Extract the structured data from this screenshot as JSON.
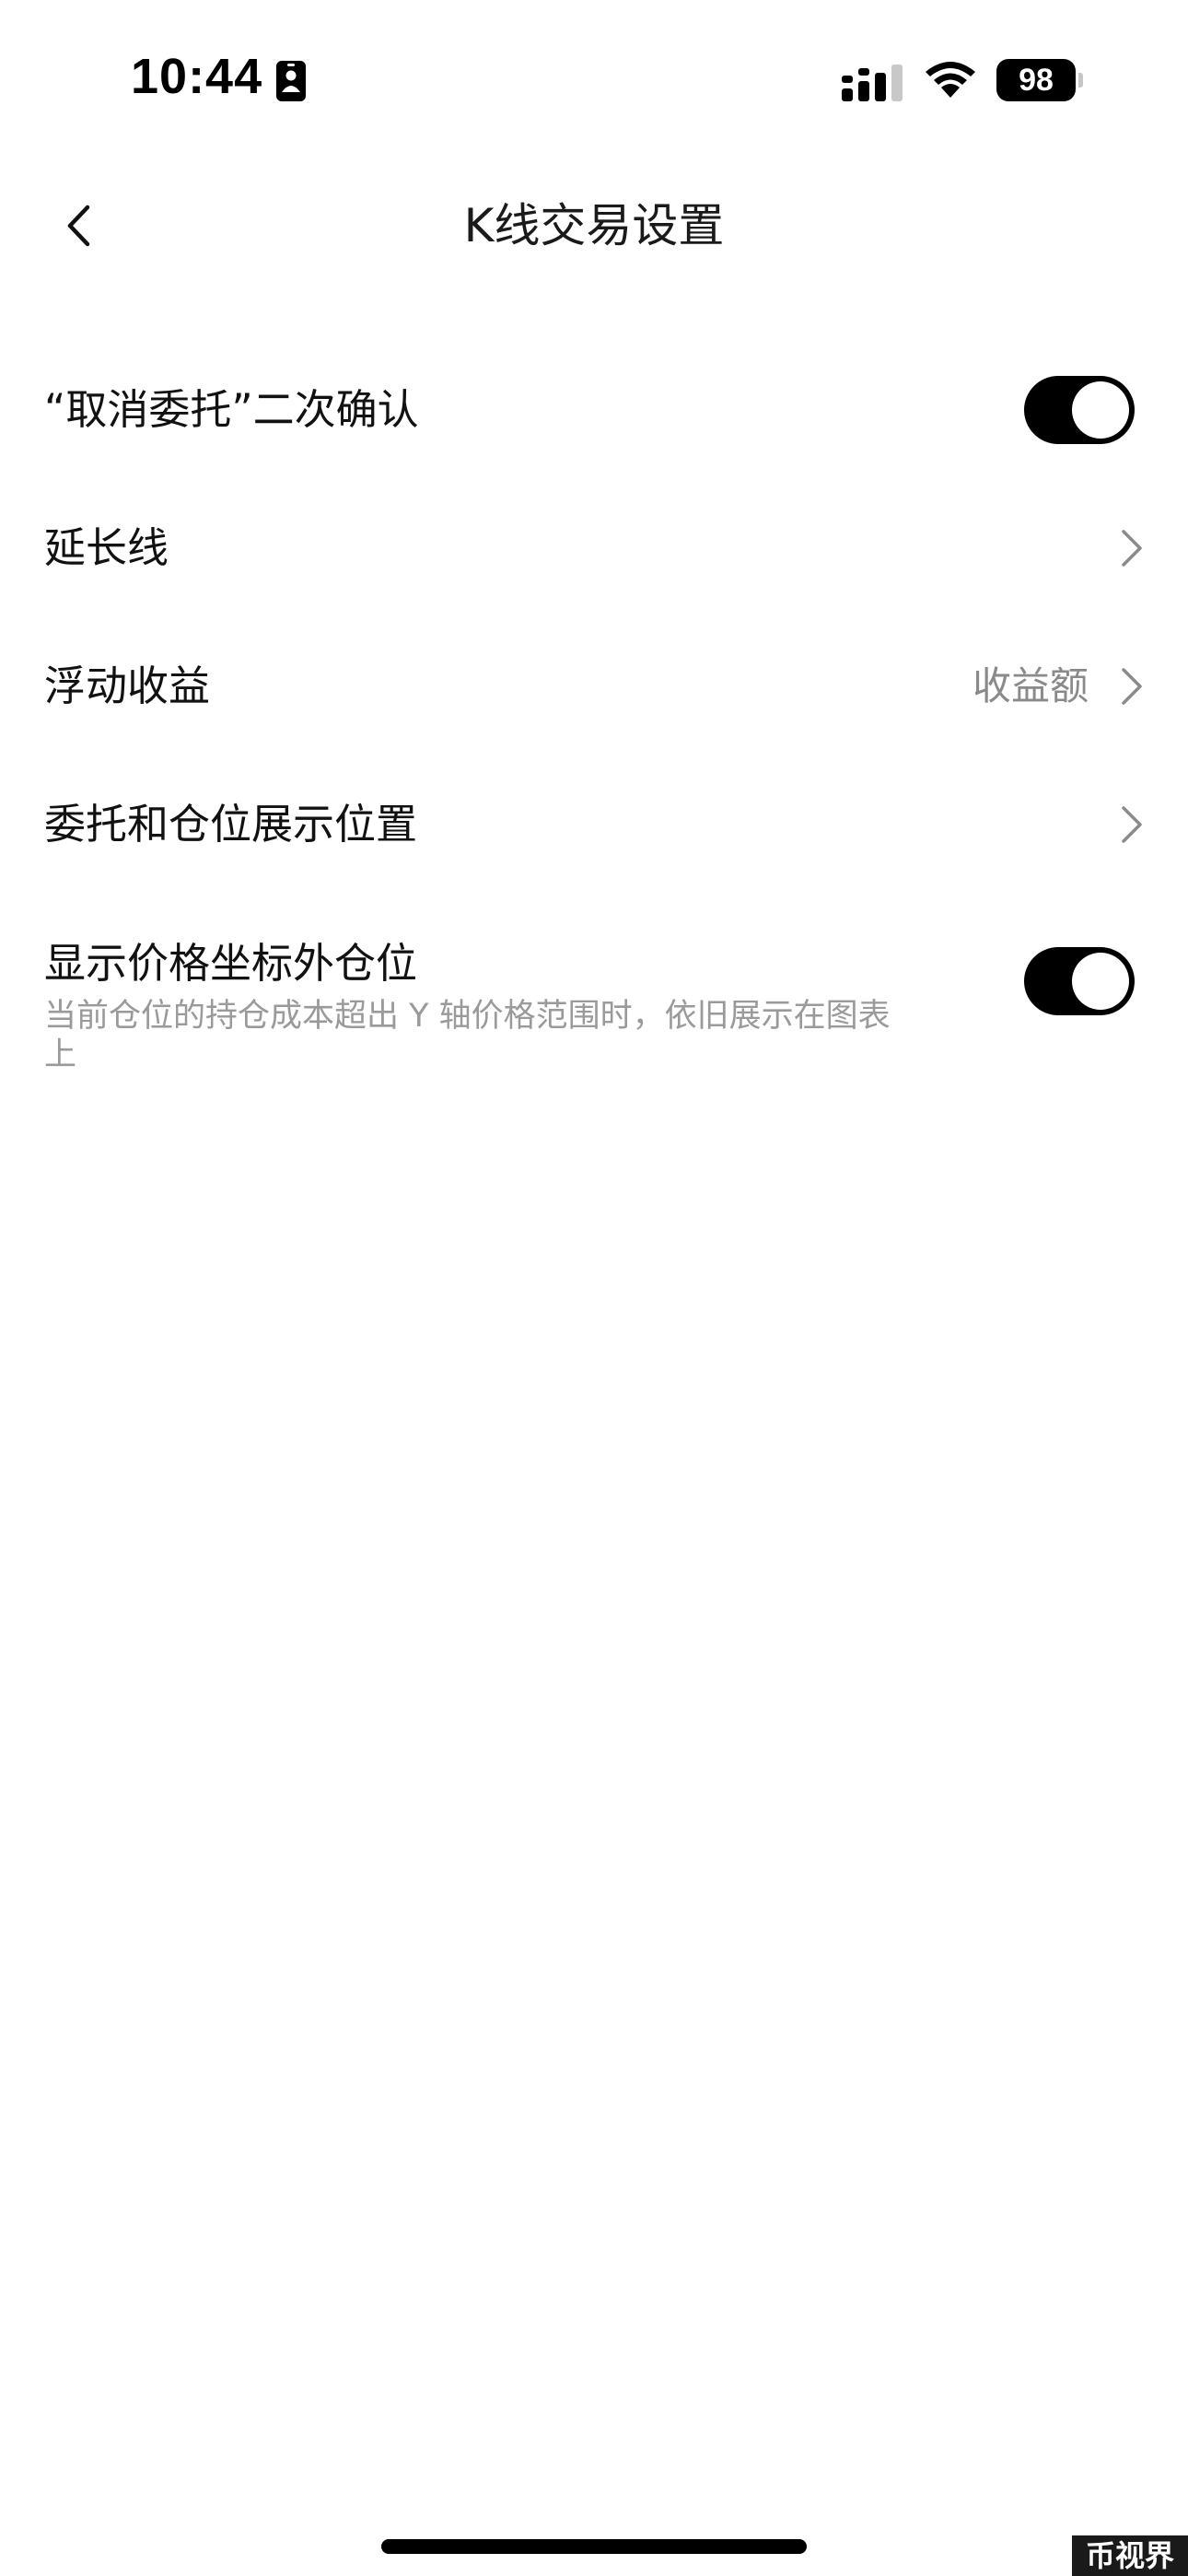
{
  "status_bar": {
    "time": "10:44",
    "battery_level": "98",
    "icons": [
      "id-card-icon",
      "cellular-signal-icon",
      "wifi-icon",
      "battery-icon"
    ]
  },
  "nav": {
    "title": "K线交易设置",
    "back_icon": "chevron-left-icon"
  },
  "settings": {
    "cancel_order_confirm": {
      "label": "“取消委托”二次确认",
      "enabled": true
    },
    "extension_line": {
      "label": "延长线"
    },
    "floating_pnl": {
      "label": "浮动收益",
      "value": "收益额"
    },
    "order_position_display": {
      "label": "委托和仓位展示位置"
    },
    "show_out_of_range_positions": {
      "label": "显示价格坐标外仓位",
      "description": "当前仓位的持仓成本超出 Y 轴价格范围时，依旧展示在图表上",
      "enabled": true
    }
  },
  "watermark": "币视界",
  "colors": {
    "text_primary": "#111111",
    "text_secondary": "#9a9a9a",
    "toggle_on": "#000000",
    "background": "#ffffff"
  }
}
